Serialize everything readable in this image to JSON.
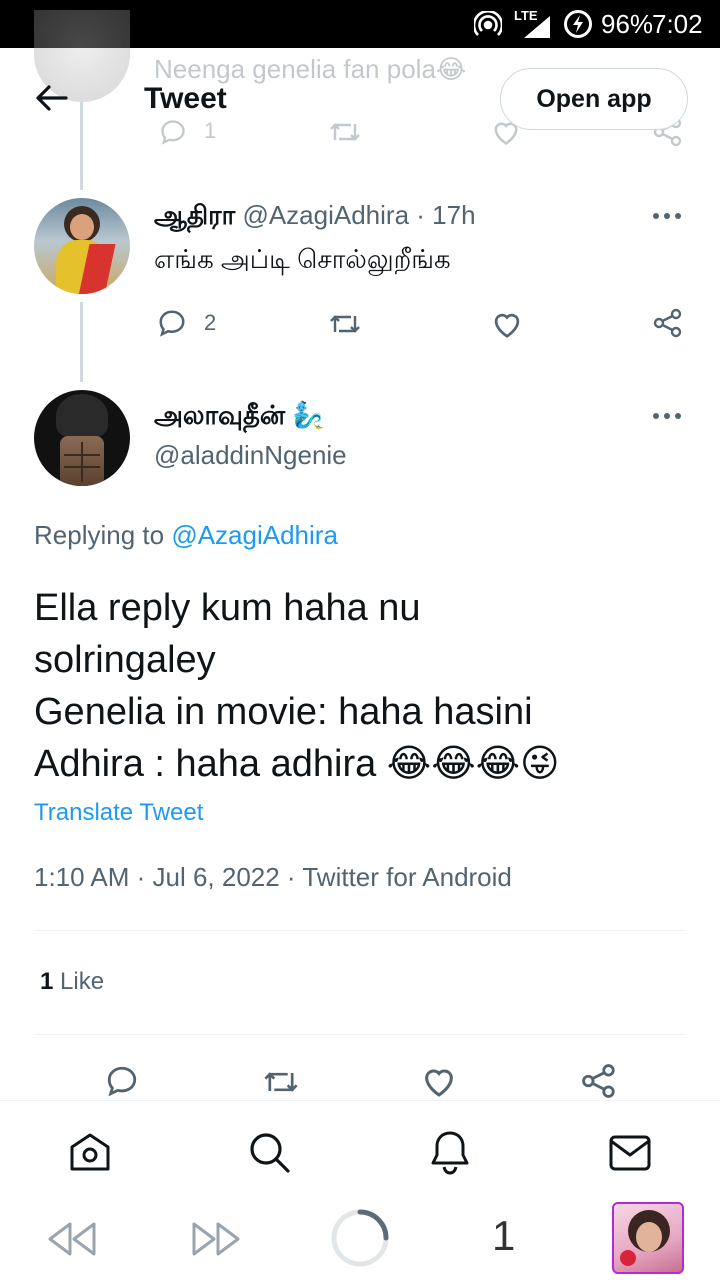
{
  "status_bar": {
    "network": "LTE",
    "battery": "96%",
    "time": "7:02"
  },
  "header": {
    "title": "Tweet",
    "open_app_label": "Open app"
  },
  "prev_tweet": {
    "text": "Neenga genelia fan pola😂",
    "reply_count": "1"
  },
  "reply_tweet": {
    "name": "ஆதிரா",
    "handle": "@AzagiAdhira",
    "time": "· 17h",
    "text": "எங்க அப்டி சொல்லுறீங்க",
    "reply_count": "2"
  },
  "main_tweet": {
    "name": "அலாவுதீன் 🧞‍♂️",
    "handle": "@aladdinNgenie",
    "replying_prefix": "Replying to ",
    "replying_handle": "@AzagiAdhira",
    "lines": [
      "Ella reply kum haha nu",
      "solringaley",
      "Genelia in movie: haha hasini",
      "Adhira : haha adhira 😂😂😂😜"
    ],
    "translate_label": "Translate Tweet",
    "meta": "1:10 AM · Jul 6, 2022 · Twitter for Android",
    "like_count": "1",
    "like_label": " Like"
  },
  "browser_nav": {
    "tab_count": "1"
  },
  "colors": {
    "accent": "#1d9bf0",
    "muted": "#536471"
  }
}
